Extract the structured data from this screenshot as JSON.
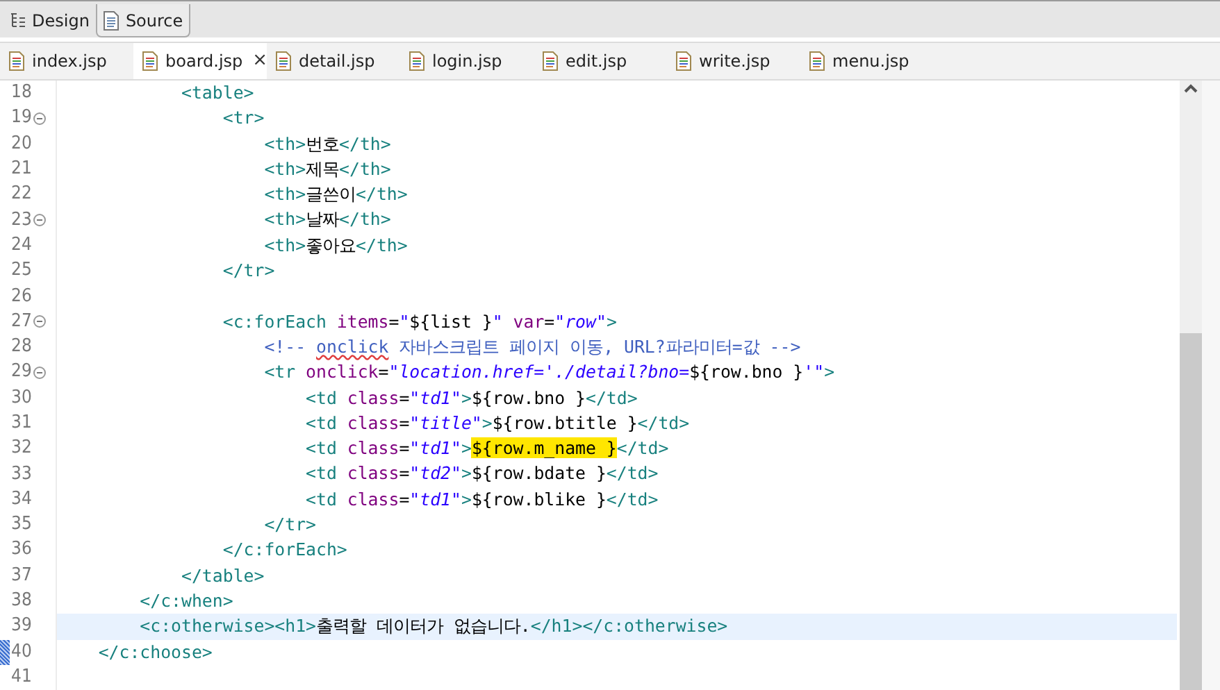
{
  "mode_tabs": [
    {
      "label": "Design",
      "selected": false
    },
    {
      "label": "Source",
      "selected": true
    }
  ],
  "file_tabs": [
    {
      "label": "index.jsp",
      "selected": false
    },
    {
      "label": "board.jsp",
      "selected": true,
      "close": "×"
    },
    {
      "label": "detail.jsp",
      "selected": false
    },
    {
      "label": "login.jsp",
      "selected": false
    },
    {
      "label": "edit.jsp",
      "selected": false
    },
    {
      "label": "write.jsp",
      "selected": false
    },
    {
      "label": "menu.jsp",
      "selected": false
    }
  ],
  "lines": [
    {
      "number": "18",
      "fold": false,
      "current": false,
      "marker": false,
      "tokens": [
        {
          "kind": "tag",
          "text": "            <table>"
        }
      ]
    },
    {
      "number": "19",
      "fold": true,
      "current": false,
      "marker": false,
      "tokens": [
        {
          "kind": "tag",
          "text": "                <tr>"
        }
      ]
    },
    {
      "number": "20",
      "fold": false,
      "current": false,
      "marker": false,
      "tokens": [
        {
          "kind": "tag",
          "text": "                    <th>"
        },
        {
          "kind": "text",
          "text": "번호"
        },
        {
          "kind": "tag",
          "text": "</th>"
        }
      ]
    },
    {
      "number": "21",
      "fold": false,
      "current": false,
      "marker": false,
      "tokens": [
        {
          "kind": "tag",
          "text": "                    <th>"
        },
        {
          "kind": "text",
          "text": "제목"
        },
        {
          "kind": "tag",
          "text": "</th>"
        }
      ]
    },
    {
      "number": "22",
      "fold": false,
      "current": false,
      "marker": false,
      "tokens": [
        {
          "kind": "tag",
          "text": "                    <th>"
        },
        {
          "kind": "text",
          "text": "글쓴이"
        },
        {
          "kind": "tag",
          "text": "</th>"
        }
      ]
    },
    {
      "number": "23",
      "fold": true,
      "current": false,
      "marker": false,
      "tokens": [
        {
          "kind": "tag",
          "text": "                    <th>"
        },
        {
          "kind": "text",
          "text": "날짜"
        },
        {
          "kind": "tag",
          "text": "</th>"
        }
      ]
    },
    {
      "number": "24",
      "fold": false,
      "current": false,
      "marker": false,
      "tokens": [
        {
          "kind": "tag",
          "text": "                    <th>"
        },
        {
          "kind": "text",
          "text": "좋아요"
        },
        {
          "kind": "tag",
          "text": "</th>"
        }
      ]
    },
    {
      "number": "25",
      "fold": false,
      "current": false,
      "marker": false,
      "tokens": [
        {
          "kind": "tag",
          "text": "                </tr>"
        }
      ]
    },
    {
      "number": "26",
      "fold": false,
      "current": false,
      "marker": false
    },
    {
      "number": "27",
      "fold": true,
      "current": false,
      "marker": false,
      "tokens": [
        {
          "kind": "tag",
          "text": "                <c:forEach"
        },
        {
          "kind": "attr",
          "text": " items"
        },
        {
          "kind": "text",
          "text": "="
        },
        {
          "kind": "str",
          "text": "\""
        },
        {
          "kind": "el",
          "text": "${list }"
        },
        {
          "kind": "str",
          "text": "\""
        },
        {
          "kind": "attr",
          "text": " var"
        },
        {
          "kind": "text",
          "text": "="
        },
        {
          "kind": "str",
          "text": "\"row\""
        },
        {
          "kind": "tag",
          "text": ">"
        }
      ]
    },
    {
      "number": "28",
      "fold": false,
      "current": false,
      "marker": false,
      "tokens": [
        {
          "kind": "comment",
          "text": "                    <!-- "
        },
        {
          "kind": "spell",
          "text": "onclick"
        },
        {
          "kind": "comment",
          "text": " 자바스크립트 페이지 이동, URL?파라미터=값 -->"
        }
      ]
    },
    {
      "number": "29",
      "fold": true,
      "current": false,
      "marker": false,
      "tokens": [
        {
          "kind": "tag",
          "text": "                    <tr"
        },
        {
          "kind": "attr",
          "text": " onclick"
        },
        {
          "kind": "text",
          "text": "="
        },
        {
          "kind": "str",
          "text": "\"location.href='./detail?bno="
        },
        {
          "kind": "el",
          "text": "${row.bno }"
        },
        {
          "kind": "str",
          "text": "'\""
        },
        {
          "kind": "tag",
          "text": ">"
        }
      ]
    },
    {
      "number": "30",
      "fold": false,
      "current": false,
      "marker": false,
      "tokens": [
        {
          "kind": "tag",
          "text": "                        <td"
        },
        {
          "kind": "attr",
          "text": " class"
        },
        {
          "kind": "text",
          "text": "="
        },
        {
          "kind": "str",
          "text": "\"td1\""
        },
        {
          "kind": "tag",
          "text": ">"
        },
        {
          "kind": "el",
          "text": "${row.bno }"
        },
        {
          "kind": "tag",
          "text": "</td>"
        }
      ]
    },
    {
      "number": "31",
      "fold": false,
      "current": false,
      "marker": false,
      "tokens": [
        {
          "kind": "tag",
          "text": "                        <td"
        },
        {
          "kind": "attr",
          "text": " class"
        },
        {
          "kind": "text",
          "text": "="
        },
        {
          "kind": "str",
          "text": "\"title\""
        },
        {
          "kind": "tag",
          "text": ">"
        },
        {
          "kind": "el",
          "text": "${row.btitle }"
        },
        {
          "kind": "tag",
          "text": "</td>"
        }
      ]
    },
    {
      "number": "32",
      "fold": false,
      "current": false,
      "marker": false,
      "tokens": [
        {
          "kind": "tag",
          "text": "                        <td"
        },
        {
          "kind": "attr",
          "text": " class"
        },
        {
          "kind": "text",
          "text": "="
        },
        {
          "kind": "str",
          "text": "\"td1\""
        },
        {
          "kind": "tag",
          "text": ">"
        },
        {
          "kind": "match",
          "text": "${row.m_name }"
        },
        {
          "kind": "tag",
          "text": "</td>"
        }
      ]
    },
    {
      "number": "33",
      "fold": false,
      "current": false,
      "marker": false,
      "tokens": [
        {
          "kind": "tag",
          "text": "                        <td"
        },
        {
          "kind": "attr",
          "text": " class"
        },
        {
          "kind": "text",
          "text": "="
        },
        {
          "kind": "str",
          "text": "\"td2\""
        },
        {
          "kind": "tag",
          "text": ">"
        },
        {
          "kind": "el",
          "text": "${row.bdate }"
        },
        {
          "kind": "tag",
          "text": "</td>"
        }
      ]
    },
    {
      "number": "34",
      "fold": false,
      "current": false,
      "marker": false,
      "tokens": [
        {
          "kind": "tag",
          "text": "                        <td"
        },
        {
          "kind": "attr",
          "text": " class"
        },
        {
          "kind": "text",
          "text": "="
        },
        {
          "kind": "str",
          "text": "\"td1\""
        },
        {
          "kind": "tag",
          "text": ">"
        },
        {
          "kind": "el",
          "text": "${row.blike }"
        },
        {
          "kind": "tag",
          "text": "</td>"
        }
      ]
    },
    {
      "number": "35",
      "fold": false,
      "current": false,
      "marker": false,
      "tokens": [
        {
          "kind": "tag",
          "text": "                    </tr>"
        }
      ]
    },
    {
      "number": "36",
      "fold": false,
      "current": false,
      "marker": false,
      "tokens": [
        {
          "kind": "tag",
          "text": "                </c:forEach>"
        }
      ]
    },
    {
      "number": "37",
      "fold": false,
      "current": false,
      "marker": false,
      "tokens": [
        {
          "kind": "tag",
          "text": "            </table>"
        }
      ]
    },
    {
      "number": "38",
      "fold": false,
      "current": false,
      "marker": false,
      "tokens": [
        {
          "kind": "tag",
          "text": "        </c:when>"
        }
      ]
    },
    {
      "number": "39",
      "fold": false,
      "current": true,
      "marker": false,
      "tokens": [
        {
          "kind": "tag",
          "text": "        <c:otherwise><h1>"
        },
        {
          "kind": "text",
          "text": "출력할 데이터가 없습니다."
        },
        {
          "kind": "tag",
          "text": "</h1></c:otherwise>"
        }
      ]
    },
    {
      "number": "40",
      "fold": false,
      "current": false,
      "marker": true,
      "tokens": [
        {
          "kind": "tag",
          "text": "    </c:choose>"
        }
      ]
    },
    {
      "number": "41",
      "fold": false,
      "current": false,
      "marker": false
    }
  ]
}
